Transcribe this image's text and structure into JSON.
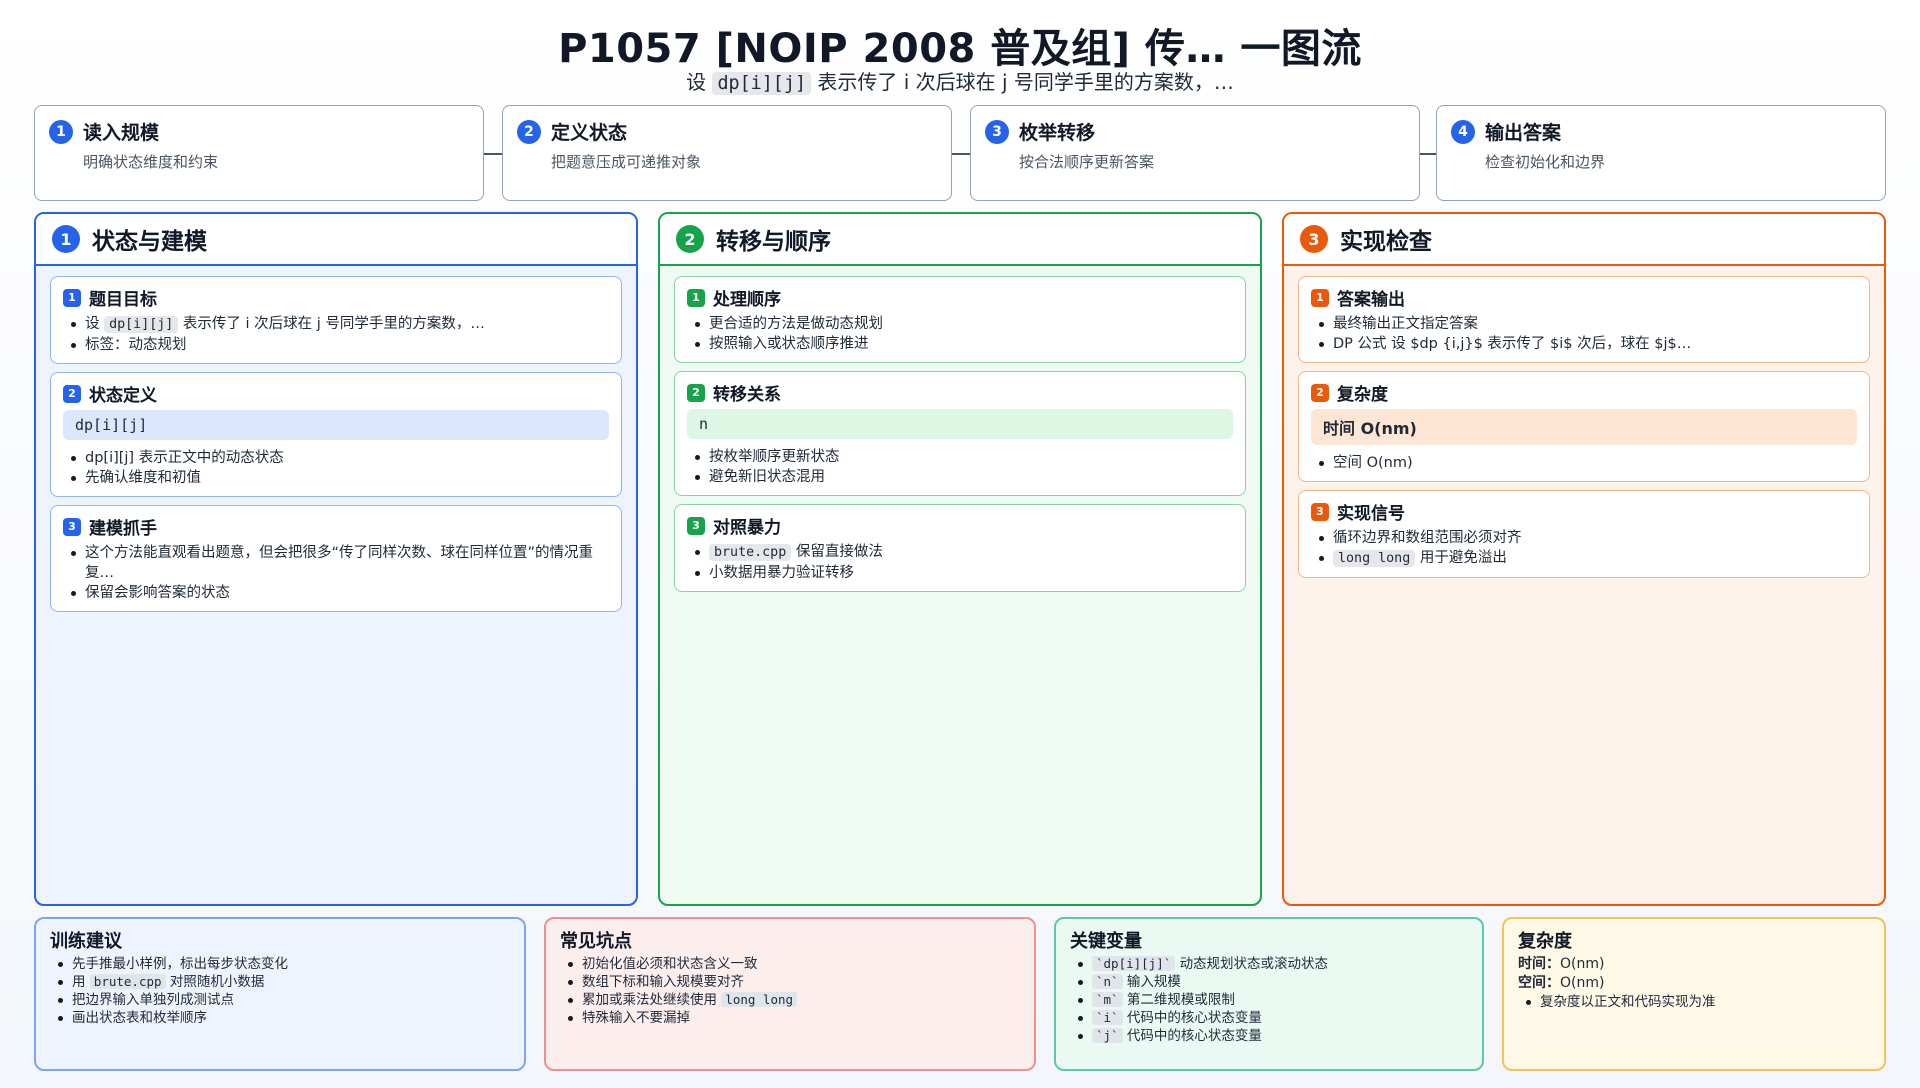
{
  "header": {
    "title": "P1057 [NOIP 2008 普及组] 传… 一图流",
    "subtitle_pre": "设",
    "subtitle_code": "dp[i][j]",
    "subtitle_post": "表示传了 i 次后球在 j 号同学手里的方案数，…"
  },
  "steps": [
    {
      "num": "1",
      "title": "读入规模",
      "desc": "明确状态维度和约束"
    },
    {
      "num": "2",
      "title": "定义状态",
      "desc": "把题意压成可递推对象"
    },
    {
      "num": "3",
      "title": "枚举转移",
      "desc": "按合法顺序更新答案"
    },
    {
      "num": "4",
      "title": "输出答案",
      "desc": "检查初始化和边界"
    }
  ],
  "col1": {
    "num": "1",
    "title": "状态与建模",
    "card1": {
      "num": "1",
      "title": "题目目标",
      "b1_pre": "设",
      "b1_code": "dp[i][j]",
      "b1_post": "表示传了 i 次后球在 j 号同学手里的方案数，…",
      "b2": "标签：动态规划"
    },
    "card2": {
      "num": "2",
      "title": "状态定义",
      "highlight": "dp[i][j]",
      "b1": "dp[i][j] 表示正文中的动态状态",
      "b2": "先确认维度和初值"
    },
    "card3": {
      "num": "3",
      "title": "建模抓手",
      "b1": "这个方法能直观看出题意，但会把很多“传了同样次数、球在同样位置”的情况重复…",
      "b2": "保留会影响答案的状态"
    }
  },
  "col2": {
    "num": "2",
    "title": "转移与顺序",
    "card1": {
      "num": "1",
      "title": "处理顺序",
      "b1": "更合适的方法是做动态规划",
      "b2": "按照输入或状态顺序推进"
    },
    "card2": {
      "num": "2",
      "title": "转移关系",
      "highlight": "n",
      "b1": "按枚举顺序更新状态",
      "b2": "避免新旧状态混用"
    },
    "card3": {
      "num": "3",
      "title": "对照暴力",
      "b1_code": "brute.cpp",
      "b1_post": "保留直接做法",
      "b2": "小数据用暴力验证转移"
    }
  },
  "col3": {
    "num": "3",
    "title": "实现检查",
    "card1": {
      "num": "1",
      "title": "答案输出",
      "b1": "最终输出正文指定答案",
      "b2": "DP 公式 设 $dp {i,j}$ 表示传了 $i$ 次后，球在 $j$…"
    },
    "card2": {
      "num": "2",
      "title": "复杂度",
      "highlight": "时间 O(nm)",
      "b1": "空间 O(nm)"
    },
    "card3": {
      "num": "3",
      "title": "实现信号",
      "b1": "循环边界和数组范围必须对齐",
      "b2_code": "long long",
      "b2_post": "用于避免溢出"
    }
  },
  "bottom": {
    "tips": {
      "title": "训练建议",
      "b1": "先手推最小样例，标出每步状态变化",
      "b2_pre": "用",
      "b2_code": "brute.cpp",
      "b2_post": "对照随机小数据",
      "b3": "把边界输入单独列成测试点",
      "b4": "画出状态表和枚举顺序"
    },
    "pitfalls": {
      "title": "常见坑点",
      "b1": "初始化值必须和状态含义一致",
      "b2": "数组下标和输入规模要对齐",
      "b3_pre": "累加或乘法处继续使用",
      "b3_code": "long long",
      "b4": "特殊输入不要漏掉"
    },
    "vars": {
      "title": "关键变量",
      "v1_code": "`dp[i][j]`",
      "v1": "动态规划状态或滚动状态",
      "v2_code": "`n`",
      "v2": "输入规模",
      "v3_code": "`m`",
      "v3": "第二维规模或限制",
      "v4_code": "`i`",
      "v4": "代码中的核心状态变量",
      "v5_code": "`j`",
      "v5": "代码中的核心状态变量"
    },
    "complexity": {
      "title": "复杂度",
      "time_label": "时间：",
      "time_value": "O(nm)",
      "space_label": "空间：",
      "space_value": "O(nm)",
      "b1": "复杂度以正文和代码实现为准"
    }
  },
  "colors": {
    "blue": "#2563eb",
    "green": "#16a34a",
    "orange": "#ea580c"
  }
}
